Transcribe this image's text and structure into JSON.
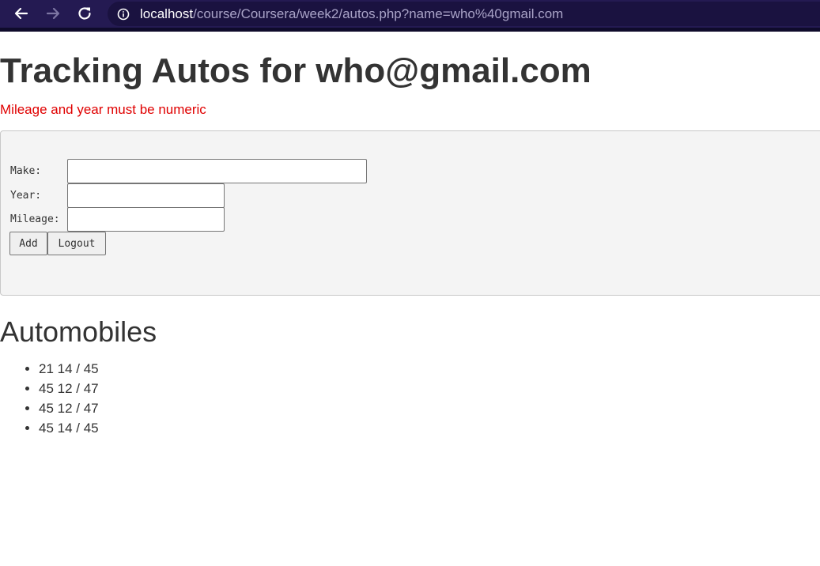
{
  "browser": {
    "url_host": "localhost",
    "url_path": "/course/Coursera/week2/autos.php?name=who%40gmail.com",
    "back_icon": "arrow-left-icon",
    "forward_icon": "arrow-right-icon",
    "reload_icon": "reload-icon",
    "info_icon": "info-icon",
    "bar_color": "#241a52"
  },
  "page": {
    "title": "Tracking Autos for who@gmail.com",
    "error": "Mileage and year must be numeric",
    "error_color": "#e00000"
  },
  "form": {
    "make_label": "Make:",
    "year_label": "Year:",
    "mileage_label": "Mileage:",
    "make_value": "",
    "year_value": "",
    "mileage_value": "",
    "add_label": "Add",
    "logout_label": "Logout"
  },
  "automobiles": {
    "heading": "Automobiles",
    "items": [
      "21 14 / 45",
      "45 12 / 47",
      "45 12 / 47",
      "45 14 / 45"
    ]
  }
}
